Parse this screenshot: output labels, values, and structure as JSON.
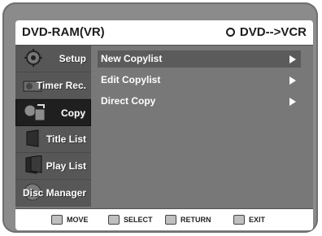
{
  "header": {
    "title_left": "DVD-RAM(VR)",
    "title_right": "DVD-->VCR"
  },
  "sidebar": {
    "items": [
      {
        "label": "Setup",
        "icon": "gear-icon"
      },
      {
        "label": "Timer Rec.",
        "icon": "timer-icon"
      },
      {
        "label": "Copy",
        "icon": "copy-icon"
      },
      {
        "label": "Title List",
        "icon": "title-list-icon"
      },
      {
        "label": "Play List",
        "icon": "play-list-icon"
      },
      {
        "label": "Disc Manager",
        "icon": "disc-manager-icon"
      }
    ],
    "active": "Copy"
  },
  "menu": {
    "items": [
      {
        "label": "New Copylist"
      },
      {
        "label": "Edit Copylist"
      },
      {
        "label": "Direct Copy"
      }
    ],
    "selected": "New Copylist"
  },
  "footer": {
    "move": "MOVE",
    "select": "SELECT",
    "return": "RETURN",
    "exit": "EXIT"
  },
  "colors": {
    "frame": "#8b8b8b",
    "sidebar": "#575757",
    "sidebar_active": "#1f1f1f",
    "content": "#787878",
    "selected_row": "#5b5b5b"
  }
}
